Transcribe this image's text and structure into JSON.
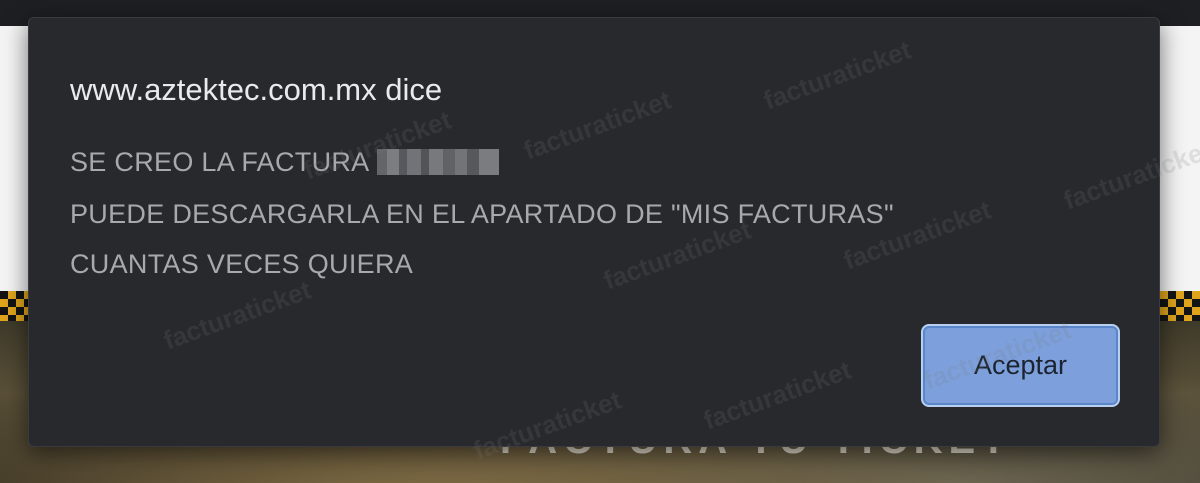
{
  "dialog": {
    "title": "www.aztektec.com.mx dice",
    "message_line1": "SE CREO LA FACTURA",
    "message_line2": "PUEDE DESCARGARLA EN EL APARTADO DE \"MIS FACTURAS\"",
    "message_line3": "CUANTAS VECES QUIERA",
    "ok_label": "Aceptar"
  },
  "background": {
    "hero_text": "FACTURA TU TICKET"
  },
  "watermark": {
    "text": "facturaticket"
  },
  "colors": {
    "dialog_bg": "#28292d",
    "button_bg": "#7da0dc",
    "accent_checker": "#e0a51c"
  }
}
